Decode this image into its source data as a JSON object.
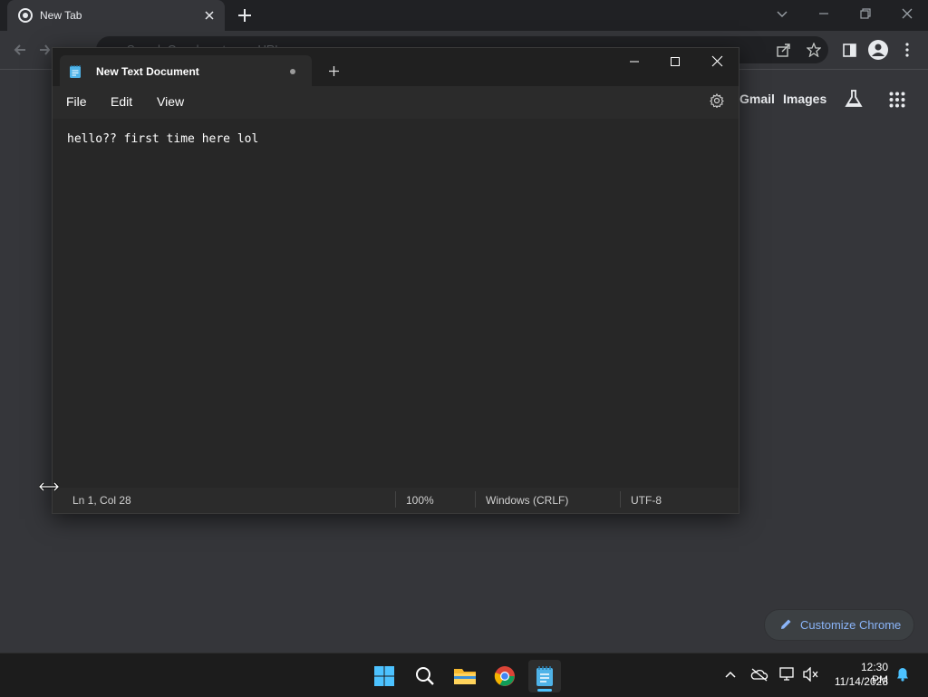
{
  "chrome": {
    "tab_title": "New Tab",
    "omnibox_placeholder": "Search Google or type a URL",
    "gmail": "Gmail",
    "images": "Images",
    "customize": "Customize Chrome"
  },
  "notepad": {
    "tab_title": "New Text Document",
    "menu": [
      "File",
      "Edit",
      "View"
    ],
    "content": "hello?? first time here lol",
    "status": {
      "position": "Ln 1, Col 28",
      "zoom": "100%",
      "line_ending": "Windows (CRLF)",
      "encoding": "UTF-8"
    }
  },
  "taskbar": {
    "time": "12:30 PM",
    "date": "11/14/2023"
  },
  "colors": {
    "chrome_bg": "#35363a",
    "notepad_bg": "#272727",
    "accent": "#4cc2ff",
    "link": "#8ab4f8"
  },
  "icons": [
    "chrome-icon",
    "close-icon",
    "plus-icon",
    "minimize-icon",
    "maximize-icon",
    "back-icon",
    "forward-icon",
    "reload-icon",
    "share-icon",
    "star-icon",
    "side-panel-icon",
    "profile-icon",
    "more-icon",
    "labs-icon",
    "apps-icon",
    "notepad-icon",
    "gear-icon",
    "resize-cursor-icon",
    "pencil-icon",
    "windows-start-icon",
    "search-icon",
    "file-explorer-icon",
    "chevron-up-icon",
    "onedrive-icon",
    "network-icon",
    "volume-mute-icon",
    "bell-icon"
  ]
}
